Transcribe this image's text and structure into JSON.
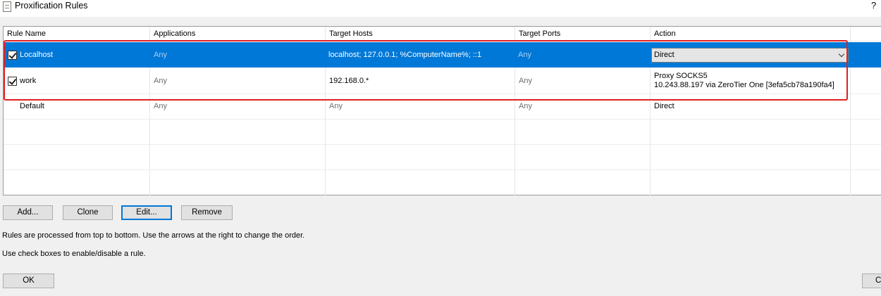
{
  "window": {
    "title": "Proxification Rules",
    "help_label": "?"
  },
  "table": {
    "columns": [
      "Rule Name",
      "Applications",
      "Target Hosts",
      "Target Ports",
      "Action"
    ],
    "rows": [
      {
        "enabled": true,
        "selected": true,
        "name": "Localhost",
        "applications": "Any",
        "target_hosts": "localhost; 127.0.0.1; %ComputerName%; ::1",
        "target_ports": "Any",
        "action": "Direct"
      },
      {
        "enabled": true,
        "selected": false,
        "name": "work",
        "applications": "Any",
        "target_hosts": "192.168.0.*",
        "target_ports": "Any",
        "action_line1": "Proxy SOCKS5",
        "action_line2": "10.243.88.197 via ZeroTier One [3efa5cb78a190fa4]"
      },
      {
        "enabled": null,
        "selected": false,
        "name": "Default",
        "applications": "Any",
        "target_hosts": "Any",
        "target_ports": "Any",
        "action": "Direct"
      }
    ]
  },
  "buttons": {
    "add": "Add...",
    "clone": "Clone",
    "edit": "Edit...",
    "remove": "Remove",
    "ok": "OK",
    "cancel_partial": "C"
  },
  "info": {
    "line1": "Rules are processed from top to bottom. Use the arrows at the right to change the order.",
    "line2": "Use check boxes to enable/disable a rule."
  },
  "colors": {
    "selection": "#0078d7",
    "highlight_annotation": "#e02020"
  }
}
